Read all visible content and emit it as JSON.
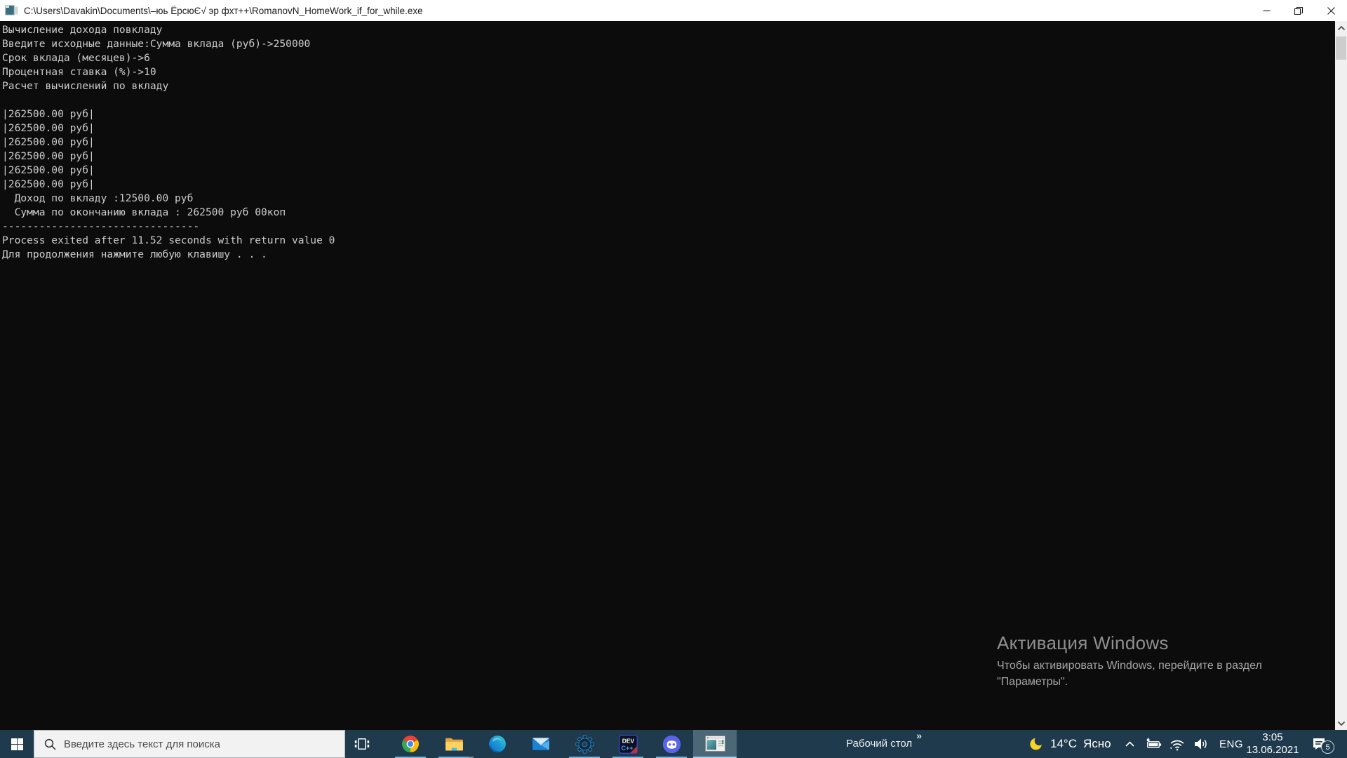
{
  "window": {
    "title": "C:\\Users\\Davakin\\Documents\\–юь ЁрсюЄ√ эр фхт++\\RomanovN_HomeWork_if_for_while.exe",
    "controls": [
      "minimize-icon",
      "restore-icon",
      "close-icon"
    ]
  },
  "console": {
    "lines": [
      "Вычисление дохода повкладу",
      "Введите исходные данные:Сумма вклада (руб)->250000",
      "Срок вклада (месяцев)->6",
      "Процентная ставка (%)->10",
      "Расчет вычислений по вкладу",
      "",
      "|262500.00 руб|",
      "|262500.00 руб|",
      "|262500.00 руб|",
      "|262500.00 руб|",
      "|262500.00 руб|",
      "|262500.00 руб|",
      "  Доход по вкладу :12500.00 руб",
      "  Сумма по окончанию вклада : 262500 руб 00коп",
      "--------------------------------",
      "Process exited after 11.52 seconds with return value 0",
      "Для продолжения нажмите любую клавишу . . ."
    ]
  },
  "watermark": {
    "title": "Активация Windows",
    "line1": "Чтобы активировать Windows, перейдите в раздел",
    "line2": "\"Параметры\"."
  },
  "taskbar": {
    "start": {
      "icon": "windows-start-icon"
    },
    "search": {
      "icon": "search-icon",
      "placeholder": "Введите здесь текст для поиска"
    },
    "task_view": {
      "icon": "task-view-icon"
    },
    "apps": [
      {
        "icon": "chrome-icon",
        "running": true,
        "active": false
      },
      {
        "icon": "file-explorer-icon",
        "running": true,
        "active": false
      },
      {
        "icon": "edge-icon",
        "running": false,
        "active": false
      },
      {
        "icon": "mail-icon",
        "running": false,
        "active": false
      },
      {
        "icon": "gear-app-icon",
        "running": true,
        "active": false
      },
      {
        "icon": "dev-cpp-icon",
        "running": true,
        "active": false,
        "label_top": "DEV",
        "label_bottom": "C++"
      },
      {
        "icon": "discord-icon",
        "running": true,
        "active": false
      },
      {
        "icon": "console-window-icon",
        "running": true,
        "active": true
      }
    ],
    "desktop_toolbar": {
      "label": "Рабочий стол",
      "overflow": "»"
    },
    "weather": {
      "icon": "moon-icon",
      "temperature": "14°C",
      "condition": "Ясно"
    },
    "tray": {
      "icons": [
        "chevron-up-icon",
        "battery-icon",
        "wifi-icon",
        "speaker-icon"
      ],
      "language": "ENG"
    },
    "clock": {
      "time": "3:05",
      "date": "13.06.2021"
    },
    "notifications": {
      "icon": "notification-icon",
      "badge": "5"
    }
  },
  "colors": {
    "taskbar": "#1e3a4c",
    "accent_underline": "#74b3dd",
    "console_bg": "#0c0c0c",
    "console_text": "#cccccc",
    "titlebar_bg": "#ffffff"
  }
}
